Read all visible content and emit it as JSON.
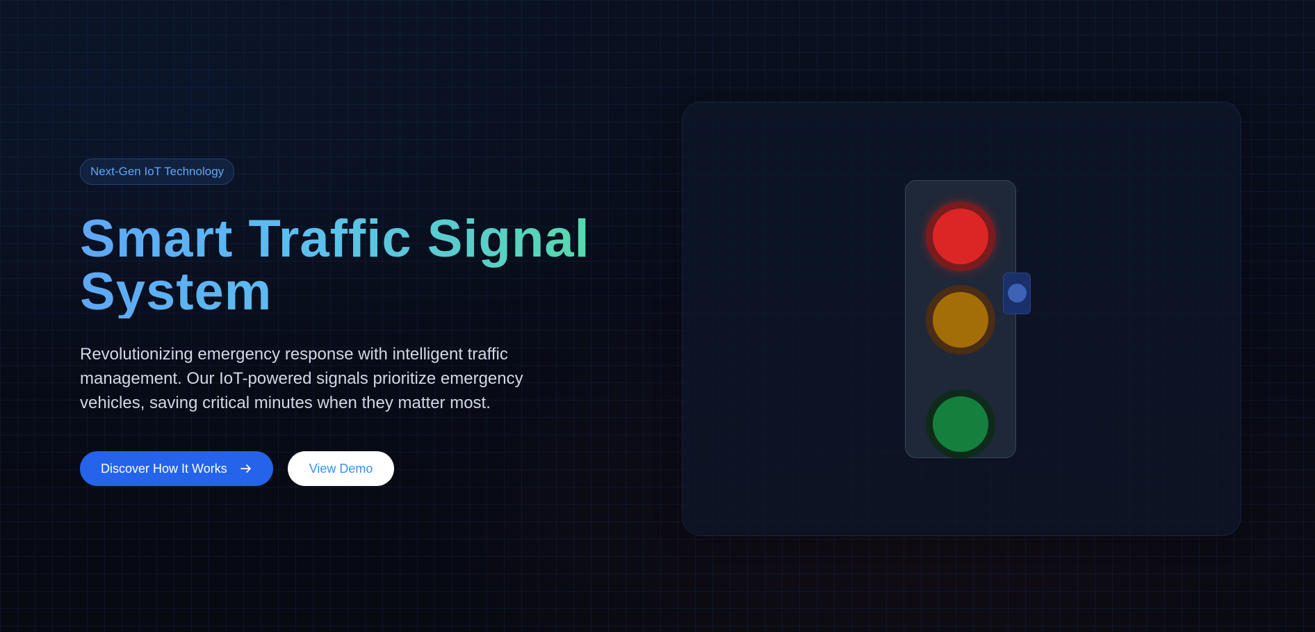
{
  "hero": {
    "badge": "Next-Gen IoT Technology",
    "title_line1": "Smart Traffic Signal",
    "title_line2": "System",
    "description": "Revolutionizing emergency response with intelligent traffic management. Our IoT-powered signals prioritize emergency vehicles, saving critical minutes when they matter most.",
    "primary_button": "Discover How It Works",
    "primary_button_icon": "arrow-right-icon",
    "secondary_button": "View Demo"
  },
  "signal": {
    "lamps": [
      "red",
      "yellow",
      "green"
    ],
    "active_lamp": "red",
    "sensor_icon": "sensor-icon"
  },
  "colors": {
    "accent_blue": "#2563eb",
    "title_gradient_start": "#5ea7f6",
    "title_gradient_end": "#56dba8",
    "red_lamp": "#dc2626",
    "yellow_lamp": "#a36e07",
    "green_lamp": "#15803d"
  }
}
